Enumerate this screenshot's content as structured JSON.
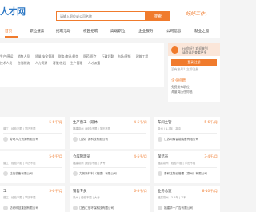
{
  "header": {
    "logo": "人才网",
    "search_placeholder": "请输入职位或公司名称",
    "search_button": "搜索",
    "slogan": "好好工作，"
  },
  "nav": {
    "items": [
      "首页",
      "职位搜索",
      "招聘活动",
      "校园招聘",
      "高端职位",
      "企业服务",
      "公司信息",
      "就业之窗"
    ]
  },
  "categories": {
    "row1": [
      "生产/营运",
      "销售人员",
      "质量/安全管理",
      "财务/审计/税务",
      "医药/医疗",
      "行政后勤",
      "市场/营销",
      "建筑工程"
    ],
    "row2": [
      "技术人员",
      "仓储物流",
      "人力资源",
      "客服/售后",
      "生产管理",
      "人才派遣"
    ]
  },
  "sidebar": {
    "welcome": "Hi 你好！欢迎来到",
    "login_prompt": "请登录后查看更多",
    "button": "登录/注册",
    "login_hint": "没有账号？立即注册",
    "section_title": "企业招聘",
    "section_line1": "免费发布职位",
    "section_line2": "海量简历任你选"
  },
  "jobs": [
    {
      "title": "",
      "salary": "5-6千/月",
      "meta": "普工 | 经验不限 | 学历不限",
      "company": "劳动人力资源有限公司"
    },
    {
      "title": "生产普工（双休）",
      "salary": "4-5千/月",
      "meta": "福建泉州 | 经验不限 | 学历不限",
      "company": "江苏广源科技有限公司"
    },
    {
      "title": "车间主管",
      "salary": "5-6千/月",
      "meta": "泉州 | 1-3年 | 高中",
      "company": "江苏同辉智能装备有限公司"
    },
    {
      "title": "",
      "salary": "5-6千/月",
      "meta": "普工 | 经验不限 | 学历不限",
      "company": "达信装备有限公司"
    },
    {
      "title": "仓库管理员",
      "salary": "4-5千/月",
      "meta": "福建泉州 | 经验不限 | 大专",
      "company": "力帆新材料（福建）有限公司"
    },
    {
      "title": "保洁员",
      "salary": "3-4千/月",
      "meta": "福建泉州 | 经验不限 | 学历不限",
      "company": "泰和达物业管理（泉州）有限公司"
    },
    {
      "title": "工",
      "salary": "5-6千/月",
      "meta": "普工 | 经验不限 | 学历不限",
      "company": "纺织科技集团有限公司"
    },
    {
      "title": "销售专员",
      "salary": "6-8千/月",
      "meta": "泉州 | 经验不限 | 大专",
      "company": "江西汇信环保科技有限公司"
    },
    {
      "title": "业务总监",
      "salary": "8-10千/月",
      "meta": "福建泉州 | 3-5年 | 本科",
      "company": "福建华一广告有限公司"
    }
  ]
}
